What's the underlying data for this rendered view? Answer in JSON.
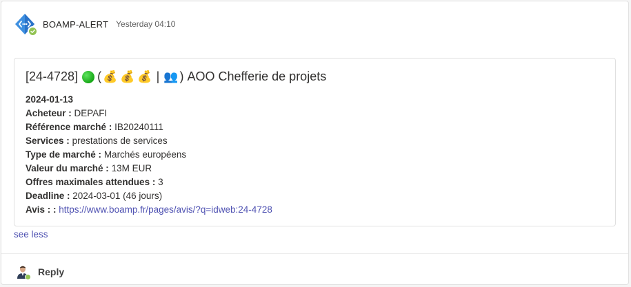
{
  "message": {
    "sender": "BOAMP-ALERT",
    "timestamp": "Yesterday 04:10",
    "avatar_icon": "shield-app-icon",
    "accent_color": "#4a90e2",
    "presence_color": "#92c353"
  },
  "card": {
    "title_ref": "[24-4728]",
    "title_paren_open": "(",
    "title_sep": "|",
    "title_paren_close": ")",
    "title_text": "AOO Chefferie de projets",
    "emojis": {
      "money_bag": "💰",
      "people": "👥"
    },
    "date": "2024-01-13",
    "fields": [
      {
        "label": "Acheteur :",
        "value": "DEPAFI"
      },
      {
        "label": "Référence marché :",
        "value": "IB20240111"
      },
      {
        "label": "Services :",
        "value": "prestations de services"
      },
      {
        "label": "Type de marché :",
        "value": "Marchés européens"
      },
      {
        "label": "Valeur du marché :",
        "value": "13M EUR"
      },
      {
        "label": "Offres maximales attendues :",
        "value": "3"
      },
      {
        "label": "Deadline :",
        "value": "2024-03-01 (46 jours)"
      }
    ],
    "avis_label": "Avis : :",
    "avis_url": "https://www.boamp.fr/pages/avis/?q=idweb:24-4728"
  },
  "see_less": "see less",
  "reply": {
    "label": "Reply"
  }
}
